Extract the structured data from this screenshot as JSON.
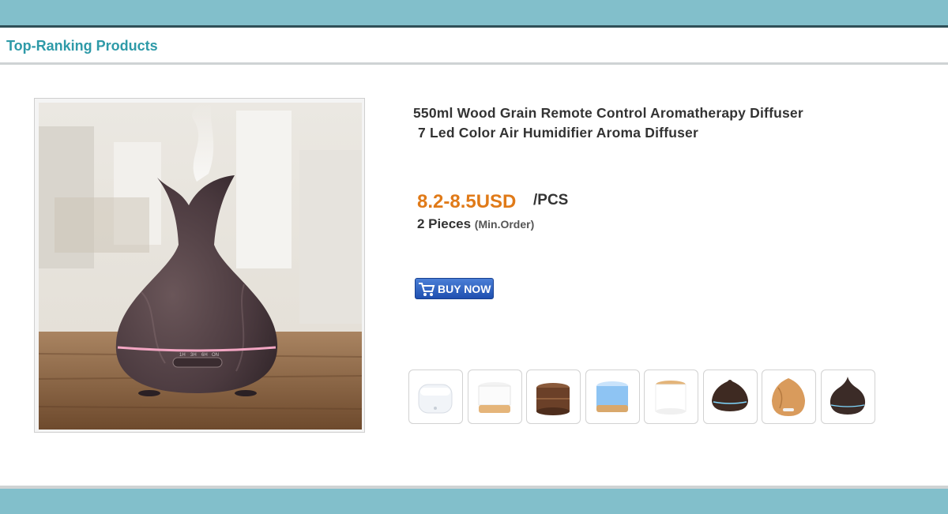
{
  "section": {
    "title": "Top-Ranking Products"
  },
  "product": {
    "title_line1": "550ml Wood Grain Remote Control Aromatherapy Diffuser",
    "title_line2": "7 Led Color Air Humidifier Aroma Diffuser",
    "price": "8.2-8.5USD",
    "unit": "/PCS",
    "moq": "2 Pieces",
    "moq_note": "(Min.Order)",
    "buy_label": "BUY NOW",
    "buy_icon": "shopping-cart-icon",
    "main_image_icon": "aroma-diffuser-wood-vase",
    "main_image_buttons": [
      "1H",
      "3H",
      "6H",
      "ON"
    ]
  },
  "thumbnails": [
    {
      "name": "white-diffuser"
    },
    {
      "name": "white-diffuser-light-wood-base"
    },
    {
      "name": "dark-wood-diffuser"
    },
    {
      "name": "blue-lit-diffuser"
    },
    {
      "name": "white-diffuser-wood-base"
    },
    {
      "name": "dark-wood-dome-diffuser"
    },
    {
      "name": "light-wood-drop-diffuser"
    },
    {
      "name": "dark-wood-onion-diffuser"
    }
  ],
  "colors": {
    "band": "#82bfcb",
    "title": "#2e9aa8",
    "price": "#e07a18",
    "button": "#2a5ec4"
  }
}
